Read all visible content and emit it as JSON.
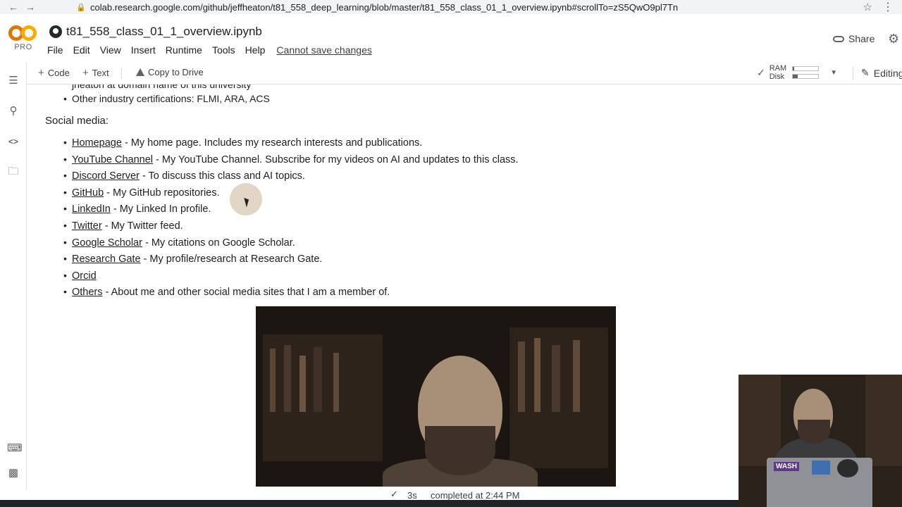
{
  "browser": {
    "url": "colab.research.google.com/github/jeffheaton/t81_558_deep_learning/blob/master/t81_558_class_01_1_overview.ipynb#scrollTo=zS5QwO9pl7Tn"
  },
  "header": {
    "logo_badge": "PRO",
    "notebook_title": "t81_558_class_01_1_overview.ipynb",
    "menu": [
      "File",
      "Edit",
      "View",
      "Insert",
      "Runtime",
      "Tools",
      "Help"
    ],
    "save_warning": "Cannot save changes",
    "share_label": "Share"
  },
  "toolbar": {
    "code_label": "Code",
    "text_label": "Text",
    "copy_to_drive_label": "Copy to Drive",
    "ram_label": "RAM",
    "disk_label": "Disk",
    "ram_usage": 0.05,
    "disk_usage": 0.2,
    "editing_label": "Editing"
  },
  "content": {
    "partial_line": "jheaton at domain name of this university",
    "certifications": "Other industry certifications: FLMI, ARA, ACS",
    "social_heading": "Social media:",
    "links": [
      {
        "link": "Homepage",
        "desc": " - My home page. Includes my research interests and publications."
      },
      {
        "link": "YouTube Channel",
        "desc": " - My YouTube Channel. Subscribe for my videos on AI and updates to this class."
      },
      {
        "link": "Discord Server",
        "desc": " - To discuss this class and AI topics."
      },
      {
        "link": "GitHub",
        "desc": " - My GitHub repositories."
      },
      {
        "link": "LinkedIn",
        "desc": " - My Linked In profile."
      },
      {
        "link": "Twitter",
        "desc": " - My Twitter feed."
      },
      {
        "link": "Google Scholar",
        "desc": " - My citations on Google Scholar."
      },
      {
        "link": "Research Gate",
        "desc": " - My profile/research at Research Gate."
      },
      {
        "link": "Orcid",
        "desc": ""
      },
      {
        "link": "Others",
        "desc": " - About me and other social media sites that I am a member of."
      }
    ]
  },
  "status": {
    "duration": "3s",
    "completed": "completed at 2:44 PM"
  },
  "pip": {
    "sticker_1": "WASH"
  },
  "colors": {
    "logo_orange": "#e37400",
    "logo_yellow": "#f9ab00",
    "text": "#202124",
    "muted": "#5f6368"
  }
}
